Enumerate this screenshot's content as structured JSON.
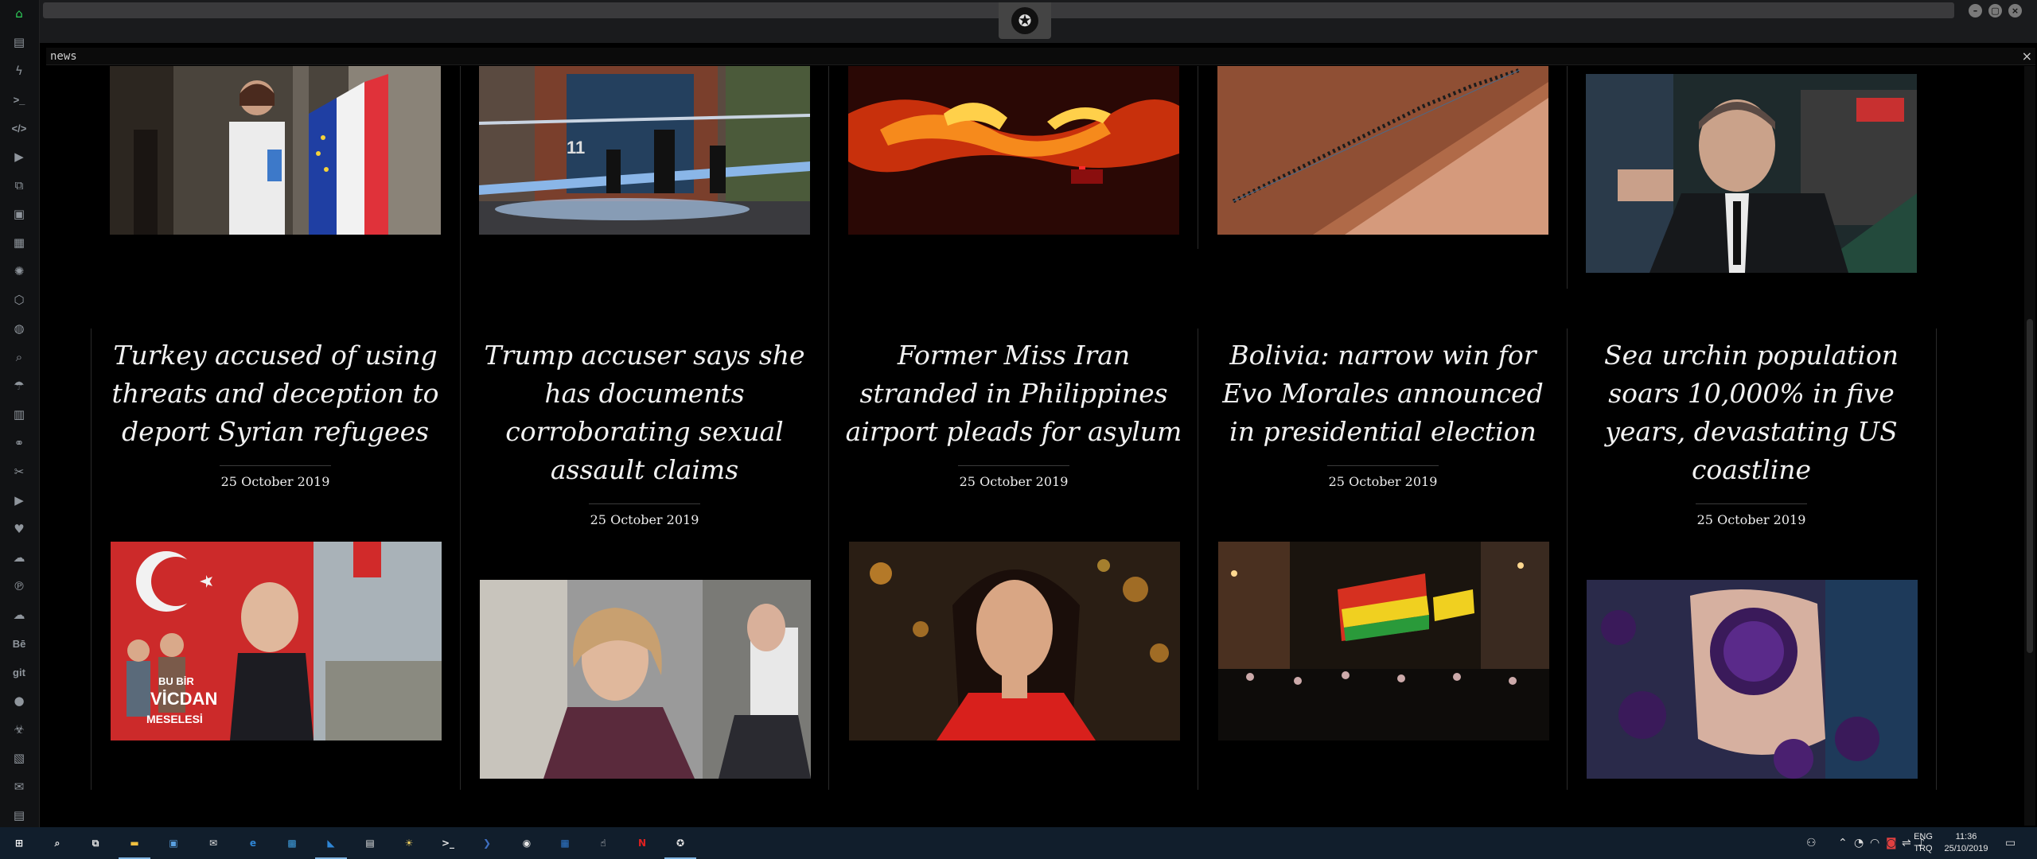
{
  "window": {
    "title": "news",
    "close_glyph": "×"
  },
  "sidebar": {
    "items": [
      {
        "name": "home-icon",
        "glyph": "⌂"
      },
      {
        "name": "document-icon",
        "glyph": "▤"
      },
      {
        "name": "lightning-icon",
        "glyph": "ϟ"
      },
      {
        "name": "terminal-icon",
        "glyph": ">_"
      },
      {
        "name": "code-icon",
        "glyph": "</>"
      },
      {
        "name": "play-circle-icon",
        "glyph": "▶"
      },
      {
        "name": "copy-icon",
        "glyph": "⧉"
      },
      {
        "name": "image-icon",
        "glyph": "▣"
      },
      {
        "name": "newspaper-icon",
        "glyph": "▦"
      },
      {
        "name": "aperture-icon",
        "glyph": "✺"
      },
      {
        "name": "hexagon-icon",
        "glyph": "⬡"
      },
      {
        "name": "globe-icon",
        "glyph": "◍"
      },
      {
        "name": "search-icon",
        "glyph": "⌕"
      },
      {
        "name": "umbrella-icon",
        "glyph": "☂"
      },
      {
        "name": "contact-card-icon",
        "glyph": "▥"
      },
      {
        "name": "link-icon",
        "glyph": "⚭"
      },
      {
        "name": "scissors-icon",
        "glyph": "✂"
      },
      {
        "name": "youtube-icon",
        "glyph": "▶"
      },
      {
        "name": "heart-icon",
        "glyph": "♥"
      },
      {
        "name": "cloud-sync-icon",
        "glyph": "☁"
      },
      {
        "name": "pinterest-icon",
        "glyph": "℗"
      },
      {
        "name": "cloud-icon",
        "glyph": "☁"
      },
      {
        "name": "behance-icon",
        "glyph": "Bē"
      },
      {
        "name": "git-icon",
        "glyph": "git"
      },
      {
        "name": "github-icon",
        "glyph": "●"
      },
      {
        "name": "biohazard-icon",
        "glyph": "☣"
      },
      {
        "name": "map-icon",
        "glyph": "▧"
      },
      {
        "name": "mail-icon",
        "glyph": "✉"
      },
      {
        "name": "server-icon",
        "glyph": "▤"
      }
    ]
  },
  "top_photos": [
    {
      "name": "photo-elysee-woman",
      "desc": "woman with EU and French flags"
    },
    {
      "name": "photo-police-tape",
      "desc": "police tape outside building"
    },
    {
      "name": "photo-wildfire",
      "desc": "wildfire at night"
    },
    {
      "name": "photo-uluru-climbers",
      "desc": "climbers on rock"
    },
    {
      "name": "photo-man-suit",
      "desc": "man in suit beside car"
    }
  ],
  "articles": [
    {
      "headline": "Turkey accused of using threats and deception to deport Syrian refugees",
      "date": "25 October 2019"
    },
    {
      "headline": "Trump accuser says she has documents corroborating sexual assault claims",
      "date": "25 October 2019"
    },
    {
      "headline": "Former Miss Iran stranded in Philippines airport pleads for asylum",
      "date": "25 October 2019"
    },
    {
      "headline": "Bolivia: narrow win for Evo Morales announced in presidential election",
      "date": "25 October 2019"
    },
    {
      "headline": "Sea urchin population soars 10,000% in five years, devastating US coastline",
      "date": "25 October 2019"
    }
  ],
  "poster_text": {
    "line1": "BU BİR",
    "line2": "VİCDAN",
    "line3": "MESELESİ"
  },
  "taskbar": {
    "apps": [
      {
        "name": "start-icon",
        "glyph": "⊞"
      },
      {
        "name": "search-icon",
        "glyph": "⌕"
      },
      {
        "name": "task-view-icon",
        "glyph": "⧉"
      },
      {
        "name": "file-explorer-icon",
        "glyph": "▬"
      },
      {
        "name": "store-icon",
        "glyph": "▣"
      },
      {
        "name": "mail-app-icon",
        "glyph": "✉"
      },
      {
        "name": "edge-icon",
        "glyph": "e"
      },
      {
        "name": "photos-app-icon",
        "glyph": "▩"
      },
      {
        "name": "vscode-icon",
        "glyph": "◣"
      },
      {
        "name": "news-app-icon",
        "glyph": "▤"
      },
      {
        "name": "weather-icon",
        "glyph": "☀"
      },
      {
        "name": "terminal-app-icon",
        "glyph": ">_"
      },
      {
        "name": "powershell-icon",
        "glyph": "❯"
      },
      {
        "name": "chrome-icon",
        "glyph": "◉"
      },
      {
        "name": "remote-desktop-icon",
        "glyph": "▦"
      },
      {
        "name": "hand-pointer-icon",
        "glyph": "☝"
      },
      {
        "name": "netflix-icon",
        "glyph": "N"
      },
      {
        "name": "rebel-app-icon",
        "glyph": "✪"
      }
    ],
    "tray": {
      "language_line1": "ENG",
      "language_line2": "TRQ",
      "time": "11:36",
      "date": "25/10/2019"
    }
  },
  "colors": {
    "accent_green": "#2fd05a",
    "taskbar_bg": "#111e2c"
  }
}
